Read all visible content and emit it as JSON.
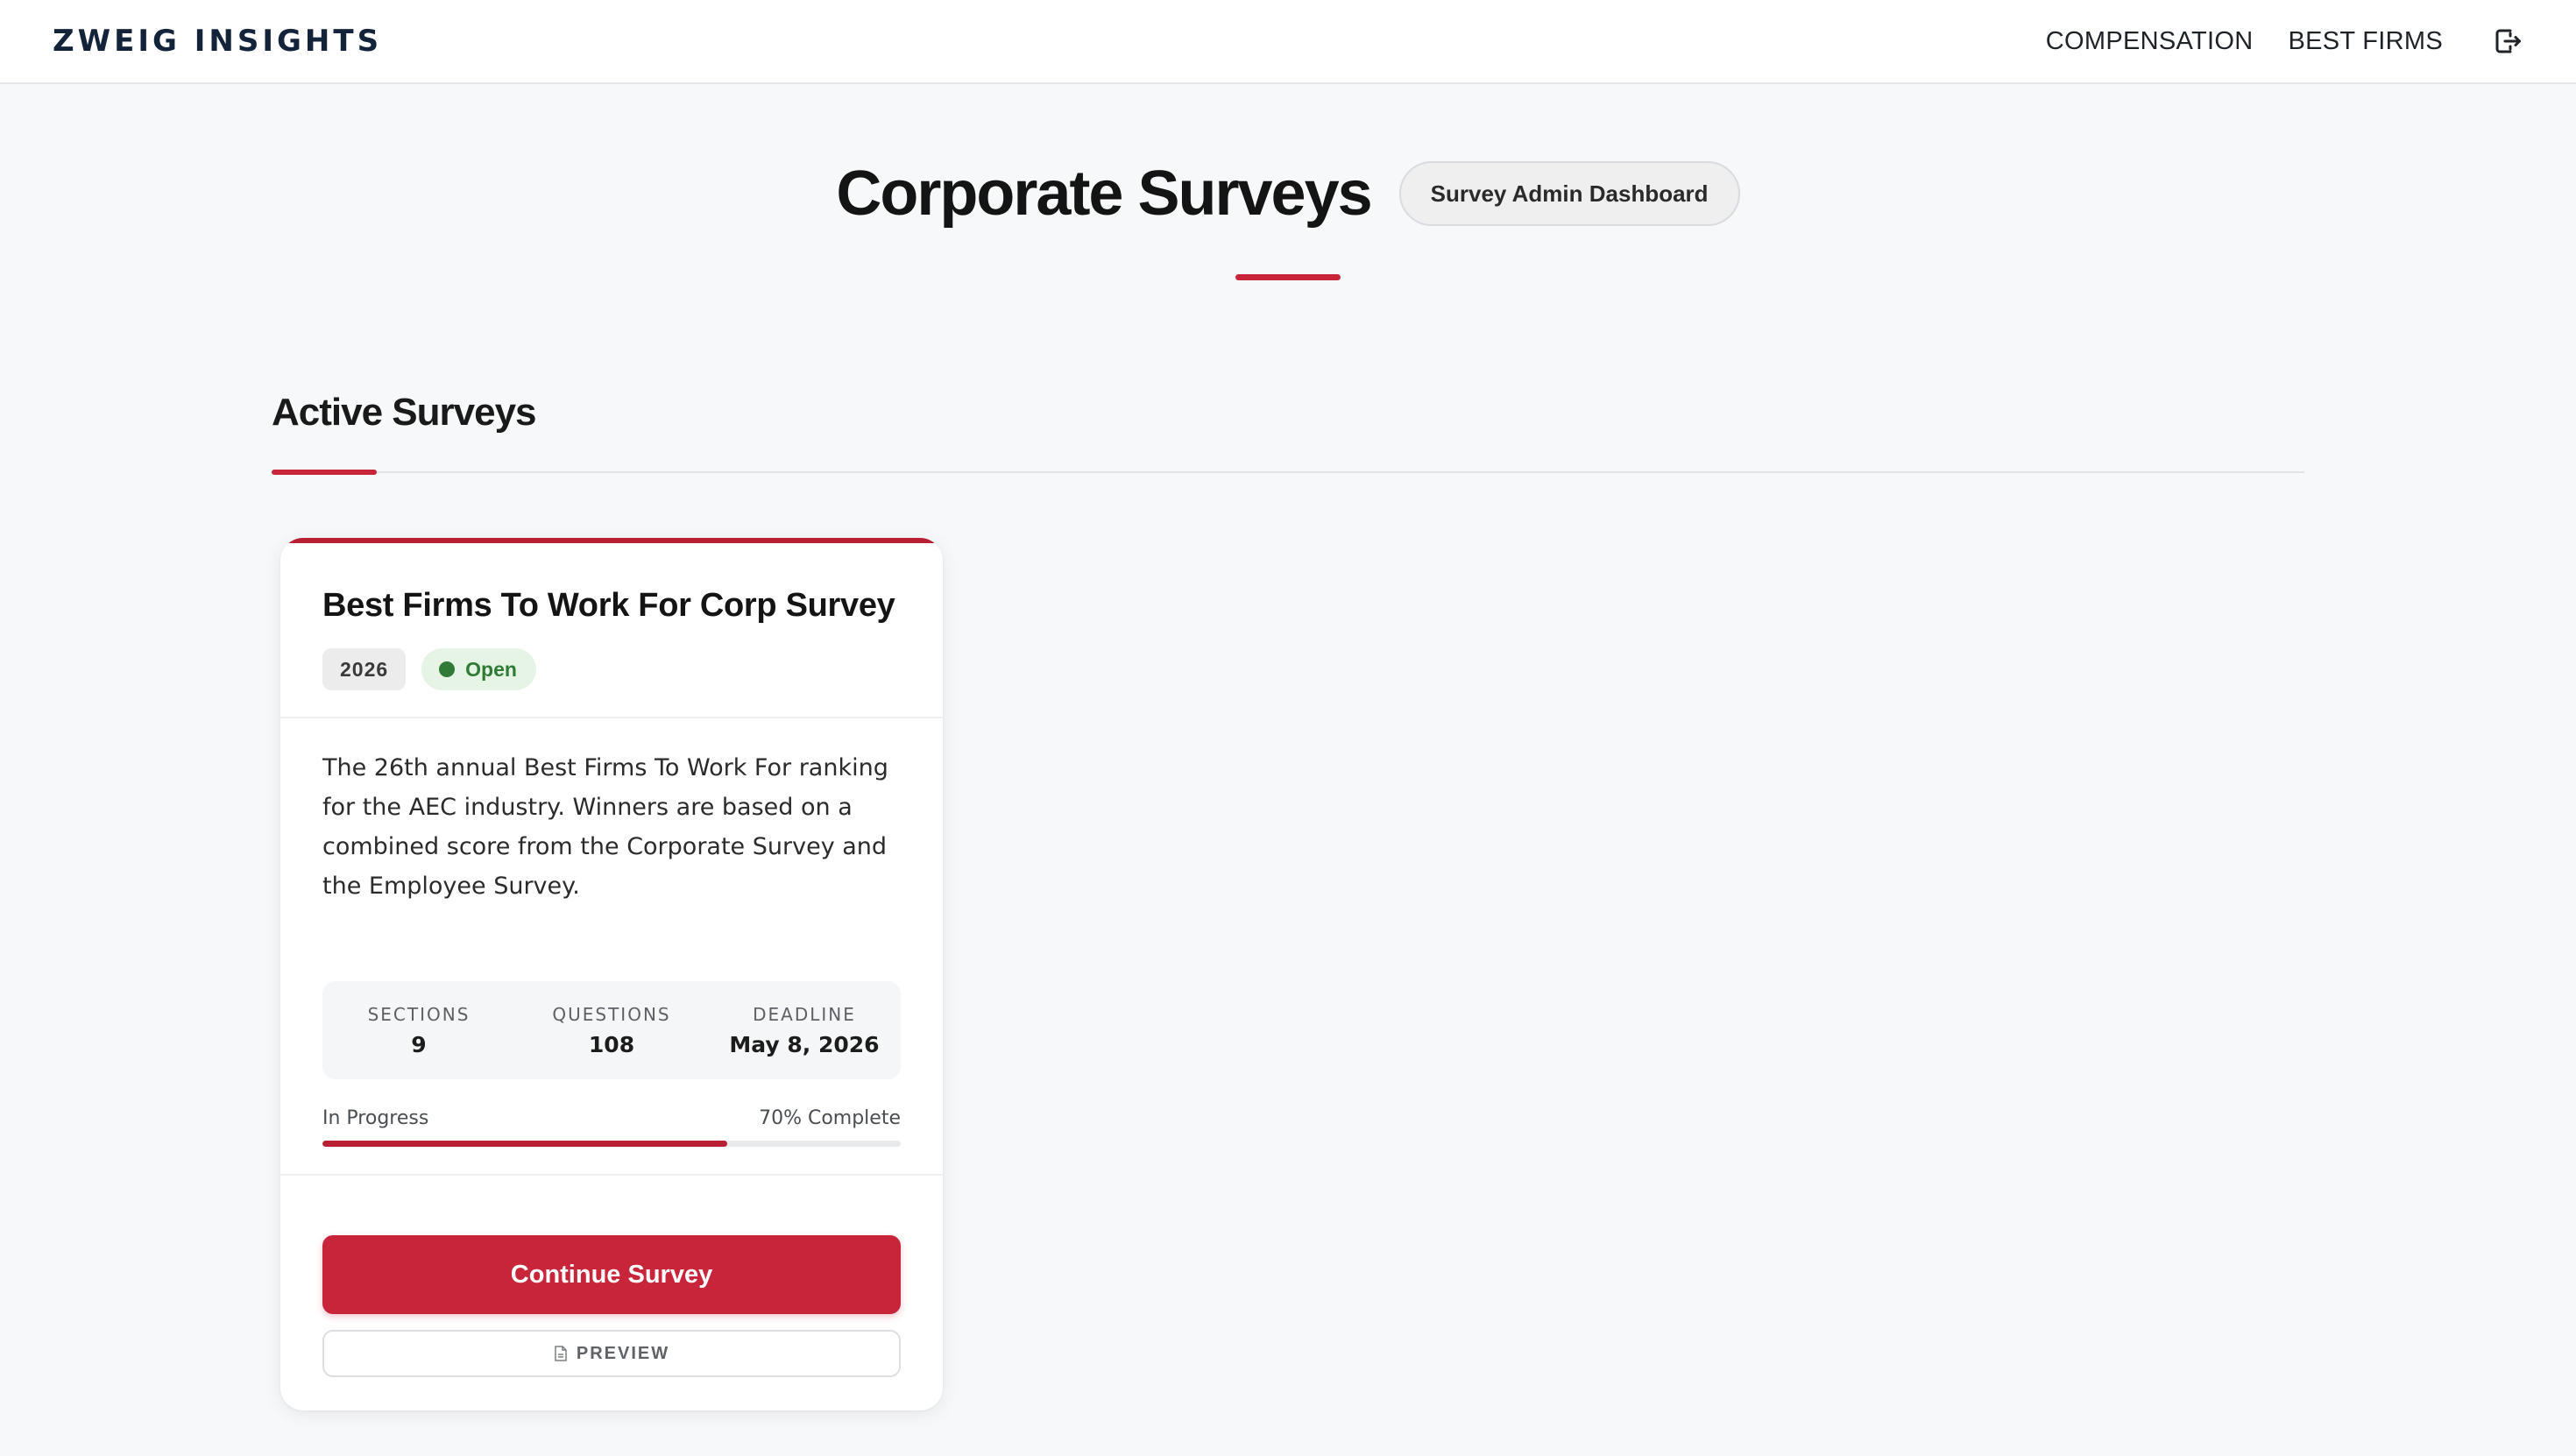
{
  "header": {
    "logo": "ZWEIG INSIGHTS",
    "nav": {
      "compensation": "COMPENSATION",
      "best_firms": "BEST FIRMS"
    },
    "logout_icon": "logout-icon"
  },
  "page": {
    "title": "Corporate Surveys",
    "admin_button": "Survey Admin Dashboard"
  },
  "section": {
    "title": "Active Surveys"
  },
  "survey_card": {
    "title": "Best Firms To Work For Corp Survey",
    "year": "2026",
    "status": "Open",
    "description": "The 26th annual Best Firms To Work For ranking for the AEC industry. Winners are based on a combined score from the Corporate Survey and the Employee Survey.",
    "stats": {
      "sections_label": "SECTIONS",
      "sections_value": "9",
      "questions_label": "QUESTIONS",
      "questions_value": "108",
      "deadline_label": "DEADLINE",
      "deadline_value": "May 8, 2026"
    },
    "progress": {
      "status_label": "In Progress",
      "complete_label": "70% Complete",
      "percent": 70
    },
    "continue_button": "Continue Survey",
    "preview_button": "PREVIEW",
    "preview_icon": "document-icon"
  },
  "colors": {
    "accent": "#c8243a",
    "status_open": "#2f7a35",
    "logo": "#13243a"
  }
}
